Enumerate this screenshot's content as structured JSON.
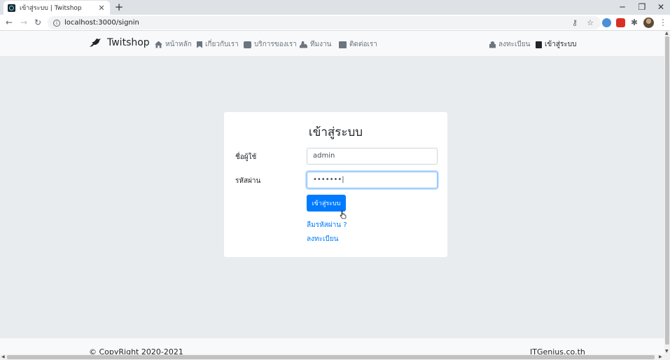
{
  "browser": {
    "tab_title": "เข้าสู่ระบบ | Twitshop",
    "tab_close": "✕",
    "new_tab": "+",
    "url": "localhost:3000/signin",
    "win_minimize": "─",
    "win_restore": "❐",
    "win_close": "✕"
  },
  "navbar": {
    "brand": "Twitshop",
    "items": [
      {
        "label": "หน้าหลัก",
        "icon": "home-icon"
      },
      {
        "label": "เกี่ยวกับเรา",
        "icon": "bookmark-icon"
      },
      {
        "label": "บริการของเรา",
        "icon": "briefcase-icon"
      },
      {
        "label": "ทีมงาน",
        "icon": "users-icon"
      },
      {
        "label": "ติดต่อเรา",
        "icon": "envelope-icon"
      }
    ],
    "register": {
      "label": "ลงทะเบียน",
      "icon": "lock-icon"
    },
    "signin": {
      "label": "เข้าสู่ระบบ",
      "icon": "book-icon"
    }
  },
  "form": {
    "title": "เข้าสู่ระบบ",
    "username_label": "ชื่อผู้ใช้",
    "username_value": "admin",
    "password_label": "รหัสผ่าน",
    "password_value": "•••••••|",
    "submit_label": "เข้าสู่ระบบ",
    "forgot_link": "ลืมรหัสผ่าน ?",
    "register_link": "ลงทะเบียน"
  },
  "footer": {
    "copyright": "© CopyRight 2020-2021",
    "company": "ITGenius.co.th"
  },
  "colors": {
    "primary": "#007bff",
    "page_bg": "#e9ecef",
    "navbar_bg": "#f8f9fa"
  }
}
